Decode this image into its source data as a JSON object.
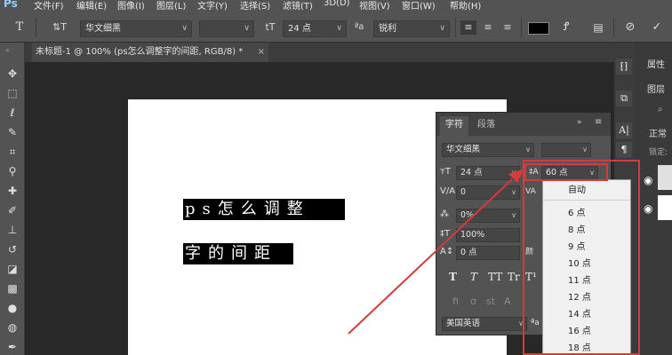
{
  "app": {
    "logo": "Ps"
  },
  "menu": [
    "文件(F)",
    "编辑(E)",
    "图像(I)",
    "图层(L)",
    "文字(Y)",
    "选择(S)",
    "滤镜(T)",
    "3D(D)",
    "视图(V)",
    "窗口(W)",
    "帮助(H)"
  ],
  "options": {
    "font_family": "华文细黑",
    "font_size": "24 点",
    "size_icon": "tT",
    "aa_icon": "ªa",
    "anti_alias": "锐利",
    "text_color": "#000000"
  },
  "document": {
    "tab_title": "未标题-1 @ 100% (ps怎么调整字的间距, RGB/8) *",
    "line1": "ps怎么调整",
    "line2": "字的间距"
  },
  "char_panel": {
    "tab_character": "字符",
    "tab_paragraph": "段落",
    "font": "华文细黑",
    "size": "24 点",
    "leading": "60 点",
    "kerning": "0",
    "tsume": "0%",
    "vscale": "100%",
    "baseline": "0 点",
    "language": "美国英语",
    "style_buttons": [
      "T",
      "T",
      "TT",
      "Tr",
      "T¹"
    ]
  },
  "leading_options": [
    "自动",
    "6 点",
    "8 点",
    "9 点",
    "10 点",
    "11 点",
    "12 点",
    "14 点",
    "16 点",
    "18 点"
  ],
  "right_panel": {
    "label1": "属性",
    "label2": "图层",
    "label3": "正常",
    "label4": "锁定:"
  },
  "colors": {
    "annotation": "#d63a3a",
    "ui_bg": "#535353",
    "canvas_bg": "#282828"
  }
}
